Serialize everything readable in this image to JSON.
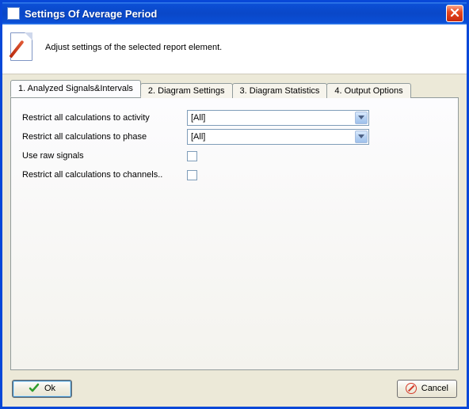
{
  "window": {
    "title": "Settings Of Average Period"
  },
  "header": {
    "description": "Adjust settings of the selected report element."
  },
  "tabs": [
    {
      "label": "1. Analyzed Signals&Intervals"
    },
    {
      "label": "2. Diagram Settings"
    },
    {
      "label": "3. Diagram Statistics"
    },
    {
      "label": "4. Output Options"
    }
  ],
  "form": {
    "activity_label": "Restrict all calculations to activity",
    "activity_value": "[All]",
    "phase_label": "Restrict all calculations to phase",
    "phase_value": "[All]",
    "raw_label": "Use raw signals",
    "channels_label": "Restrict all calculations to channels.."
  },
  "buttons": {
    "ok": "Ok",
    "cancel": "Cancel"
  }
}
